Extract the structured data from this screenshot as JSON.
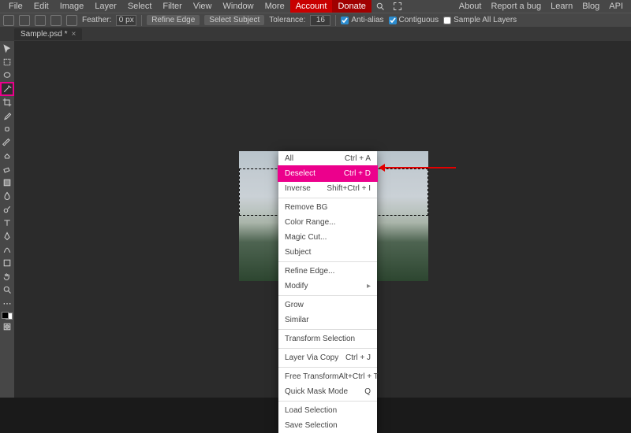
{
  "menu": {
    "file": "File",
    "edit": "Edit",
    "image": "Image",
    "layer": "Layer",
    "select": "Select",
    "filter": "Filter",
    "view": "View",
    "window": "Window",
    "more": "More",
    "account": "Account",
    "donate": "Donate",
    "about": "About",
    "bug": "Report a bug",
    "learn": "Learn",
    "blog": "Blog",
    "api": "API"
  },
  "opt": {
    "feather": "Feather:",
    "feather_val": "0 px",
    "refine": "Refine Edge",
    "subj": "Select Subject",
    "tol": "Tolerance:",
    "tol_val": "16",
    "aa": "Anti-alias",
    "contig": "Contiguous",
    "all": "Sample All Layers"
  },
  "tab": {
    "name": "Sample.psd *"
  },
  "ctx": {
    "all": "All",
    "all_k": "Ctrl + A",
    "deselect": "Deselect",
    "deselect_k": "Ctrl + D",
    "inverse": "Inverse",
    "inverse_k": "Shift+Ctrl + I",
    "removebg": "Remove BG",
    "colorrange": "Color Range...",
    "magic": "Magic Cut...",
    "subject": "Subject",
    "refine": "Refine Edge...",
    "modify": "Modify",
    "grow": "Grow",
    "similar": "Similar",
    "transform": "Transform Selection",
    "viacopy": "Layer Via Copy",
    "viacopy_k": "Ctrl + J",
    "freet": "Free Transform",
    "freet_k": "Alt+Ctrl + T",
    "qmask": "Quick Mask Mode",
    "qmask_k": "Q",
    "load": "Load Selection",
    "save": "Save Selection"
  }
}
